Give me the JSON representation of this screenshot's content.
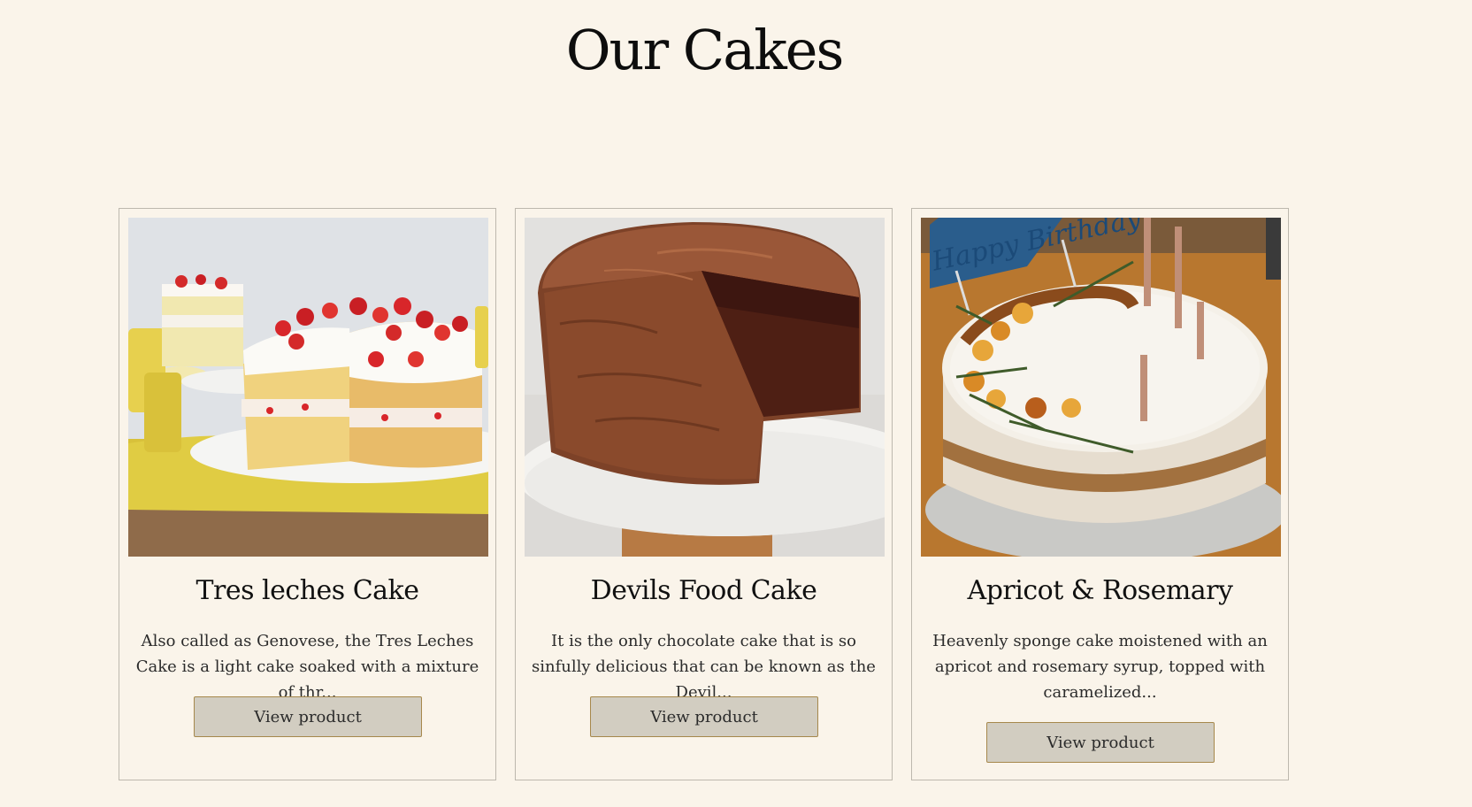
{
  "page": {
    "title": "Our Cakes"
  },
  "products": [
    {
      "title": "Tres leches Cake",
      "description": "Also called as Genovese, the Tres Leches Cake is a light cake soaked with a mixture of thr...",
      "button_label": "View product",
      "image_icon": "strawberry-sponge-cake-image"
    },
    {
      "title": "Devils Food Cake",
      "description": "It is the only chocolate cake that is so sinfully delicious that can be known as the Devil...",
      "button_label": "View product",
      "image_icon": "chocolate-layer-cake-image"
    },
    {
      "title": "Apricot & Rosemary",
      "description": "Heavenly sponge cake moistened with an apricot and rosemary syrup, topped with caramelized...",
      "button_label": "View product",
      "image_icon": "apricot-rosemary-cake-image",
      "topper_text": "Happy Birthday"
    }
  ],
  "colors": {
    "background": "#faf4ea",
    "button_bg": "#d2cdc1",
    "button_border": "#a6884c",
    "card_border": "#bdb8ae"
  }
}
